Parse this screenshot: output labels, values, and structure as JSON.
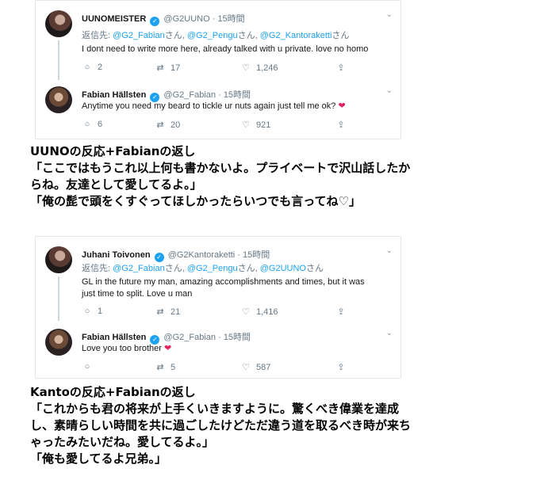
{
  "card1": {
    "tweet1": {
      "name": "UUNOMEISTER",
      "handle": "@G2UUNO",
      "dot": "·",
      "time": "15時間",
      "replying_label": "返信先: ",
      "mentions": [
        "@G2_Fabian",
        "@G2_Pengu",
        "@G2_Kantoraketti"
      ],
      "honorific": "さん",
      "separator": ", ",
      "text": "I dont need to write more here, already talked with u private. love no homo",
      "replies": "2",
      "retweets": "17",
      "likes": "1,246"
    },
    "tweet2": {
      "name": "Fabian Hällsten",
      "handle": "@G2_Fabian",
      "dot": "·",
      "time": "15時間",
      "text": "Anytime you need my beard to tickle ur nuts again just tell me ok? ",
      "replies": "6",
      "retweets": "20",
      "likes": "921"
    }
  },
  "caption1": {
    "line1": "UUNOの反応+Fabianの返し",
    "line2": "「ここではもうこれ以上何も書かないよ。プライベートで沢山話したか",
    "line3": "らね。友達として愛してるよ。」",
    "line4": "「俺の髭で頭をくすぐってほしかったらいつでも言ってね♡」"
  },
  "card2": {
    "tweet1": {
      "name": "Juhani Toivonen",
      "handle": "@G2Kantoraketti",
      "dot": "·",
      "time": "15時間",
      "replying_label": "返信先: ",
      "mentions": [
        "@G2_Fabian",
        "@G2_Pengu",
        "@G2UUNO"
      ],
      "honorific": "さん",
      "separator": ", ",
      "text_line1": "GL in the future my man, amazing accomplishments and times, but it was",
      "text_line2": "just time to split. Love u man",
      "replies": "1",
      "retweets": "21",
      "likes": "1,416"
    },
    "tweet2": {
      "name": "Fabian Hällsten",
      "handle": "@G2_Fabian",
      "dot": "·",
      "time": "15時間",
      "text": "Love you too brother ",
      "replies": "",
      "retweets": "5",
      "likes": "587"
    }
  },
  "caption2": {
    "line1": "Kantoの反応+Fabianの返し",
    "line2": "「これからも君の将来が上手くいきますように。驚くべき偉業を達成",
    "line3": "し、素晴らしい時間を共に過ごしたけどただ違う道を取るべき時が来ち",
    "line4": "ゃったみたいだね。愛してるよ。」",
    "line5": "「俺も愛してるよ兄弟。」"
  },
  "icons": {
    "verified": "verified-badge-icon",
    "reply": "reply-icon",
    "retweet": "retweet-icon",
    "like": "heart-icon",
    "share": "share-icon",
    "chevron": "chevron-down-icon",
    "emoji_heart": "red-heart-emoji"
  },
  "colors": {
    "accent": "#1da1f2",
    "muted": "#657786",
    "heart": "#e0245e",
    "border": "#e1e8ed"
  }
}
